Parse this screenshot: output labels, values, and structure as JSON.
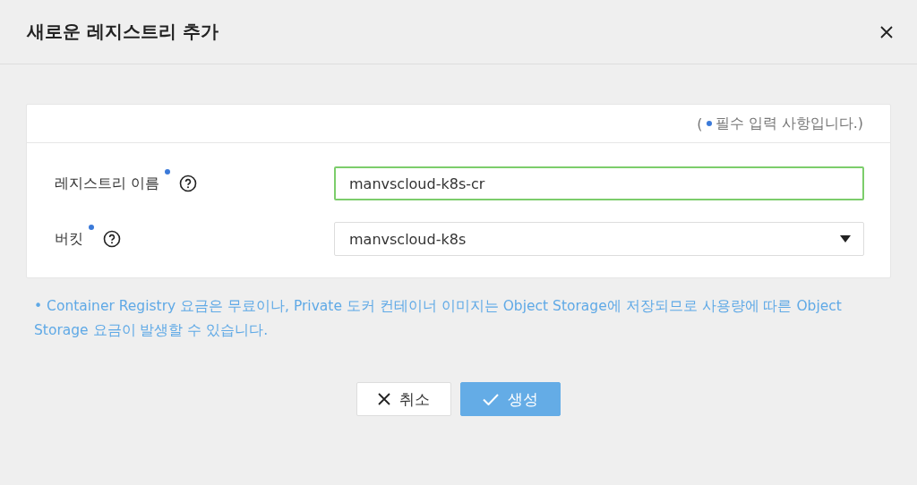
{
  "dialog": {
    "title": "새로운 레지스트리 추가"
  },
  "required_note": {
    "open": "(",
    "text": "필수 입력 사항입니다.)"
  },
  "fields": [
    {
      "kind": "text",
      "label": "레지스트리 이름",
      "required": true,
      "value": "manvscloud-k8s-cr",
      "focused": true
    },
    {
      "kind": "select",
      "label": "버킷",
      "required": true,
      "value": "manvscloud-k8s",
      "focused": false
    }
  ],
  "notice": "•  Container Registry 요금은 무료이나, Private 도커 컨테이너 이미지는 Object Storage에 저장되므로 사용량에 따른 Object Storage 요금이 발생할 수 있습니다.",
  "buttons": [
    {
      "kind": "cancel",
      "label": "취소"
    },
    {
      "kind": "primary",
      "label": "생성"
    }
  ]
}
